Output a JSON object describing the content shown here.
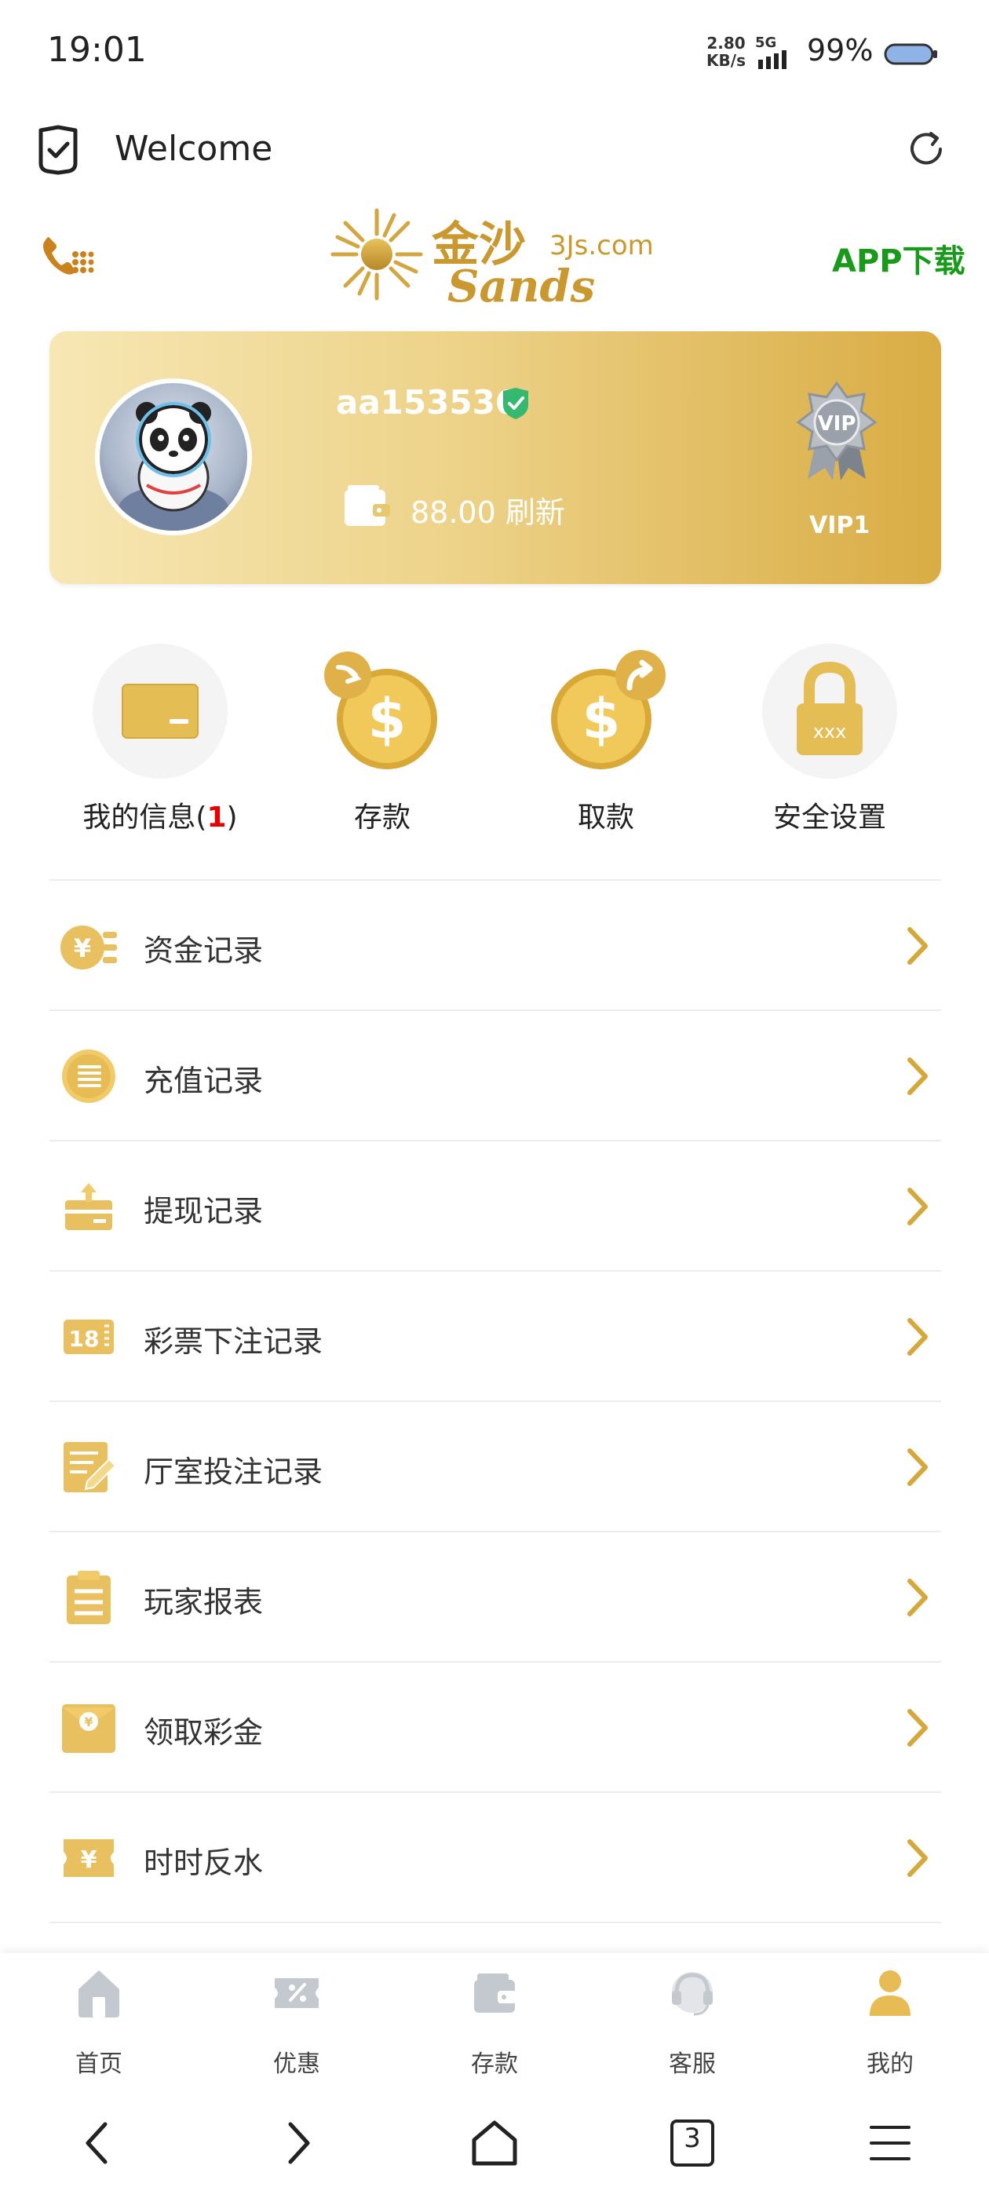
{
  "status_bar": {
    "time": "19:01",
    "net_speed_value": "2.80",
    "net_speed_unit": "KB/s",
    "network_type": "5G",
    "battery": "99%"
  },
  "header": {
    "title": "Welcome",
    "icons": [
      "shield-check-icon",
      "refresh-icon"
    ]
  },
  "brand": {
    "logo_cn": "金沙",
    "logo_site": "3Js.com",
    "logo_en": "Sands",
    "app_download": "APP下载"
  },
  "profile": {
    "username": "aa153536",
    "balance": "88.00",
    "refresh_label": "刷新",
    "vip_level": "VIP1",
    "vip_badge_text": "VIP"
  },
  "quick_actions": [
    {
      "label_prefix": "我的信息(",
      "count": "1",
      "label_suffix": ")",
      "icon": "card-icon"
    },
    {
      "label": "存款",
      "icon": "deposit-coin-icon"
    },
    {
      "label": "取款",
      "icon": "withdraw-coin-icon"
    },
    {
      "label": "安全设置",
      "icon": "lock-icon",
      "lock_text": "xxx"
    }
  ],
  "menu": [
    {
      "label": "资金记录",
      "icon": "yuan-coin-icon"
    },
    {
      "label": "充值记录",
      "icon": "list-coin-icon"
    },
    {
      "label": "提现记录",
      "icon": "withdraw-box-icon"
    },
    {
      "label": "彩票下注记录",
      "icon": "lottery-ticket-icon",
      "icon_text": "18"
    },
    {
      "label": "厅室投注记录",
      "icon": "note-pen-icon"
    },
    {
      "label": "玩家报表",
      "icon": "clipboard-icon"
    },
    {
      "label": "领取彩金",
      "icon": "envelope-icon"
    },
    {
      "label": "时时反水",
      "icon": "rebate-ticket-icon"
    }
  ],
  "bottom_nav": [
    {
      "label": "首页",
      "icon": "home-icon",
      "active": false
    },
    {
      "label": "优惠",
      "icon": "coupon-icon",
      "active": false
    },
    {
      "label": "存款",
      "icon": "wallet-icon",
      "active": false
    },
    {
      "label": "客服",
      "icon": "headset-icon",
      "active": false
    },
    {
      "label": "我的",
      "icon": "user-icon",
      "active": true
    }
  ],
  "system_nav": {
    "tabs_count": "3"
  },
  "colors": {
    "gold": "#d4a83a",
    "gold_light": "#f3dc95",
    "green": "#1a9a1a",
    "red": "#e60000"
  }
}
